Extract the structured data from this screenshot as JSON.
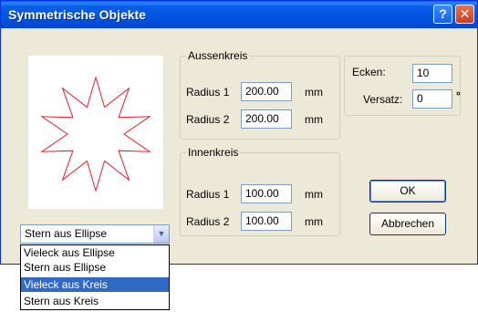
{
  "window": {
    "title": "Symmetrische Objekte"
  },
  "titlebar": {
    "help_glyph": "?",
    "close_glyph": "✕"
  },
  "aussen": {
    "legend": "Aussenkreis",
    "r1_label": "Radius 1",
    "r1_value": "200.00",
    "r1_unit": "mm",
    "r2_label": "Radius 2",
    "r2_value": "200.00",
    "r2_unit": "mm"
  },
  "innen": {
    "legend": "Innenkreis",
    "r1_label": "Radius 1",
    "r1_value": "100.00",
    "r1_unit": "mm",
    "r2_label": "Radius 2",
    "r2_value": "100.00",
    "r2_unit": "mm"
  },
  "corners": {
    "ecken_label": "Ecken:",
    "ecken_value": "10",
    "versatz_label": "Versatz:",
    "versatz_value": "0",
    "versatz_unit": "°"
  },
  "buttons": {
    "ok": "OK",
    "cancel": "Abbrechen"
  },
  "shape": {
    "selected": "Stern aus Ellipse",
    "options": [
      "Vieleck aus Ellipse",
      "Stern aus Ellipse",
      "Vieleck aus Kreis",
      "Stern aus Kreis"
    ],
    "highlighted_index": 2
  },
  "preview": {
    "points": 10,
    "stroke_color": "#e0202a"
  },
  "colors": {
    "titlebar": "#0054e3",
    "dialog_bg": "#ece9d8",
    "selection": "#316ac5"
  }
}
